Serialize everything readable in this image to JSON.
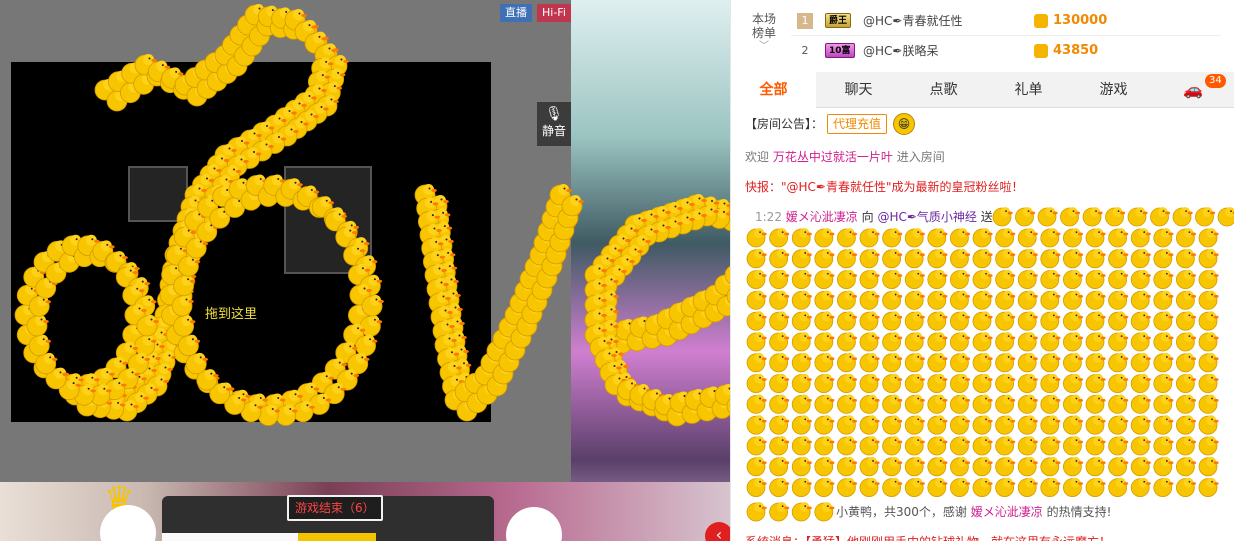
{
  "stage": {
    "badge_live": "直播",
    "badge_hifi": "Hi-Fi",
    "mute_label": "静音",
    "ghost_text": "拖到这里",
    "game_end": "游戏结束（6）"
  },
  "ranking": {
    "label": "本场榜单",
    "rows": [
      {
        "rank": "1",
        "tag": "爵王",
        "name": "@HC✒青春就任性",
        "value": "130000"
      },
      {
        "rank": "2",
        "tag": "10富",
        "name": "@HC✒朕略呆",
        "value": "43850"
      }
    ]
  },
  "tabs": [
    "全部",
    "聊天",
    "点歌",
    "礼单",
    "游戏"
  ],
  "tab_badge": "34",
  "notice": {
    "label": "【房间公告】：",
    "button": "代理充值"
  },
  "chat": {
    "welcome_prefix": "欢迎",
    "welcome_name": "万花丛中过就活一片叶",
    "welcome_suffix": "进入房间",
    "broadcast": "快报：\"@HC✒青春就任性\"成为最新的皇冠粉丝啦！",
    "gift_time": "1:22",
    "gift_sender": "嫒メ沁泚凄凉",
    "gift_to": "向",
    "gift_target": "@HC✒气质小神经",
    "gift_verb": "送",
    "thanks_text": "小黄鸭，共300个，感谢",
    "thanks_name": "嫒メ沁泚凄凉",
    "thanks_suffix": "的热情支持!",
    "sys_line": "系统消息：【勇猛】他刚刚用手中的钻球礼物，就在这里有永远魔方！"
  },
  "colors": {
    "accent": "#ff5a00",
    "coin": "#f08a00",
    "duck": "#f7c600",
    "live_badge": "#3f6fb5",
    "hifi_badge": "#c0364f"
  }
}
